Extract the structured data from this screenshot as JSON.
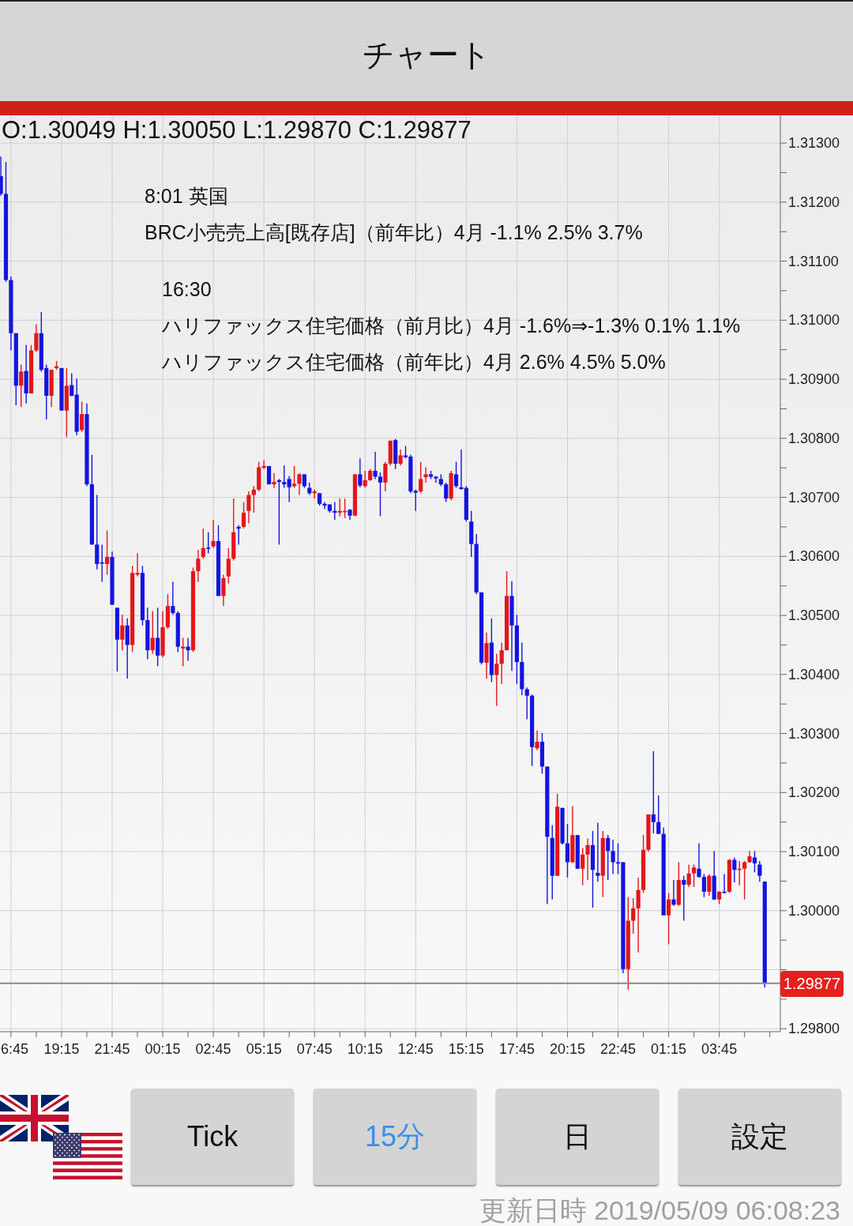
{
  "title": "チャート",
  "chart": {
    "ohlc_readout": "O:1.30049 H:1.30050 L:1.29870 C:1.29877",
    "events": [
      {
        "heading": "8:01 英国",
        "lines": [
          "BRC小売売上高[既存店]（前年比）4月 -1.1% 2.5% 3.7%"
        ]
      },
      {
        "heading": "16:30",
        "lines": [
          "ハリファックス住宅価格（前月比）4月 -1.6%⇒-1.3% 0.1% 1.1%",
          "ハリファックス住宅価格（前年比）4月 2.6% 4.5% 5.0%"
        ]
      }
    ],
    "chart_data": {
      "type": "candlestick",
      "grid": true,
      "categories": [
        null,
        null,
        "6:45",
        null,
        null,
        null,
        null,
        null,
        null,
        null,
        null,
        null,
        "19:15",
        null,
        null,
        null,
        null,
        null,
        null,
        null,
        null,
        null,
        "21:45",
        null,
        null,
        null,
        null,
        null,
        null,
        null,
        null,
        null,
        "00:15",
        null,
        null,
        null,
        null,
        null,
        null,
        null,
        null,
        null,
        "02:45",
        null,
        null,
        null,
        null,
        null,
        null,
        null,
        null,
        null,
        "05:15",
        null,
        null,
        null,
        null,
        null,
        null,
        null,
        null,
        null,
        "07:45",
        null,
        null,
        null,
        null,
        null,
        null,
        null,
        null,
        null,
        "10:15",
        null,
        null,
        null,
        null,
        null,
        null,
        null,
        null,
        null,
        "12:45",
        null,
        null,
        null,
        null,
        null,
        null,
        null,
        null,
        null,
        "15:15",
        null,
        null,
        null,
        null,
        null,
        null,
        null,
        null,
        null,
        "17:45",
        null,
        null,
        null,
        null,
        null,
        null,
        null,
        null,
        null,
        "20:15",
        null,
        null,
        null,
        null,
        null,
        null,
        null,
        null,
        null,
        "22:45",
        null,
        null,
        null,
        null,
        null,
        null,
        null,
        null,
        null,
        "01:15",
        null,
        null,
        null,
        null,
        null,
        null,
        null,
        null,
        null,
        "03:45",
        null,
        null,
        null,
        null,
        null,
        null,
        null,
        null,
        null
      ],
      "ohlc": [
        [
          1.31244,
          1.31277,
          1.31211,
          1.31214
        ],
        [
          1.31214,
          1.31268,
          1.31065,
          1.31068
        ],
        [
          1.31068,
          1.31074,
          1.30949,
          1.30978
        ],
        [
          1.30978,
          1.30978,
          1.30856,
          1.30889
        ],
        [
          1.30889,
          1.30925,
          1.30853,
          1.30913
        ],
        [
          1.30914,
          1.30958,
          1.30859,
          1.30876
        ],
        [
          1.30876,
          1.30958,
          1.30876,
          1.30949
        ],
        [
          1.30949,
          1.30993,
          1.30946,
          1.30978
        ],
        [
          1.30978,
          1.31014,
          1.30913,
          1.30916
        ],
        [
          1.30919,
          1.30925,
          1.30832,
          1.30872
        ],
        [
          1.30872,
          1.30916,
          1.30853,
          1.30916
        ],
        [
          1.30919,
          1.30931,
          1.30916,
          1.30922
        ],
        [
          1.30919,
          1.30919,
          1.30847,
          1.30847
        ],
        [
          1.30847,
          1.30919,
          1.30802,
          1.30889
        ],
        [
          1.3089,
          1.3091,
          1.30871,
          1.30872
        ],
        [
          1.30874,
          1.30901,
          1.30805,
          1.30811
        ],
        [
          1.30814,
          1.30862,
          1.30811,
          1.30841
        ],
        [
          1.30841,
          1.30859,
          1.30719,
          1.30722
        ],
        [
          1.30722,
          1.30772,
          1.3062,
          1.3062
        ],
        [
          1.3062,
          1.30704,
          1.30578,
          1.30587
        ],
        [
          1.3059,
          1.3062,
          1.30557,
          1.30588
        ],
        [
          1.30587,
          1.30644,
          1.30569,
          1.30599
        ],
        [
          1.30599,
          1.30608,
          1.30518,
          1.30518
        ],
        [
          1.30513,
          1.30513,
          1.30405,
          1.30459
        ],
        [
          1.30459,
          1.30501,
          1.30441,
          1.30483
        ],
        [
          1.30483,
          1.30495,
          1.30393,
          1.3045
        ],
        [
          1.3045,
          1.30584,
          1.30438,
          1.30572
        ],
        [
          1.30569,
          1.30605,
          1.30566,
          1.30572
        ],
        [
          1.30572,
          1.30584,
          1.30483,
          1.30492
        ],
        [
          1.30492,
          1.30513,
          1.30426,
          1.30441
        ],
        [
          1.30441,
          1.30507,
          1.30435,
          1.30462
        ],
        [
          1.30462,
          1.30513,
          1.30414,
          1.30432
        ],
        [
          1.30432,
          1.30507,
          1.30429,
          1.3048
        ],
        [
          1.3048,
          1.30536,
          1.30477,
          1.30516
        ],
        [
          1.30516,
          1.30557,
          1.30501,
          1.30504
        ],
        [
          1.30504,
          1.30507,
          1.30438,
          1.30447
        ],
        [
          1.30444,
          1.30462,
          1.30414,
          1.30447
        ],
        [
          1.30447,
          1.30462,
          1.30423,
          1.30441
        ],
        [
          1.30441,
          1.30581,
          1.30438,
          1.30575
        ],
        [
          1.30575,
          1.30611,
          1.30557,
          1.30596
        ],
        [
          1.30599,
          1.30647,
          1.30596,
          1.30614
        ],
        [
          1.30615,
          1.30641,
          1.30605,
          1.30613
        ],
        [
          1.30617,
          1.30662,
          1.30614,
          1.30626
        ],
        [
          1.30626,
          1.30653,
          1.30533,
          1.30533
        ],
        [
          1.30533,
          1.30569,
          1.30516,
          1.30563
        ],
        [
          1.30566,
          1.30614,
          1.30554,
          1.30596
        ],
        [
          1.30596,
          1.30698,
          1.30593,
          1.30641
        ],
        [
          1.3065,
          1.30653,
          1.3062,
          1.30647
        ],
        [
          1.3065,
          1.30692,
          1.30647,
          1.30674
        ],
        [
          1.30677,
          1.3071,
          1.30656,
          1.30704
        ],
        [
          1.30704,
          1.30719,
          1.30674,
          1.30713
        ],
        [
          1.30713,
          1.3076,
          1.3071,
          1.30751
        ],
        [
          1.3075,
          1.30763,
          1.30748,
          1.30753
        ],
        [
          1.30753,
          1.30753,
          1.30722,
          1.30722
        ],
        [
          1.30722,
          1.30741,
          1.30716,
          1.30726
        ],
        [
          1.30729,
          1.30731,
          1.3062,
          1.30726
        ],
        [
          1.30726,
          1.30754,
          1.30716,
          1.30722
        ],
        [
          1.30731,
          1.30736,
          1.30692,
          1.30717
        ],
        [
          1.30719,
          1.30753,
          1.30716,
          1.30723
        ],
        [
          1.30723,
          1.30741,
          1.30704,
          1.30739
        ],
        [
          1.30739,
          1.30739,
          1.30716,
          1.30719
        ],
        [
          1.30716,
          1.30725,
          1.30704,
          1.30707
        ],
        [
          1.30707,
          1.30713,
          1.30698,
          1.3071
        ],
        [
          1.30707,
          1.30707,
          1.30686,
          1.30689
        ],
        [
          1.30689,
          1.30692,
          1.3068,
          1.30686
        ],
        [
          1.30688,
          1.30688,
          1.30674,
          1.30677
        ],
        [
          1.30677,
          1.30692,
          1.30662,
          1.30674
        ],
        [
          1.30674,
          1.30698,
          1.30668,
          1.30677
        ],
        [
          1.30675,
          1.30698,
          1.30665,
          1.30677
        ],
        [
          1.30679,
          1.3068,
          1.30662,
          1.30669
        ],
        [
          1.30669,
          1.30739,
          1.30668,
          1.30739
        ],
        [
          1.30739,
          1.30766,
          1.30717,
          1.3072
        ],
        [
          1.30719,
          1.30745,
          1.30716,
          1.30729
        ],
        [
          1.30729,
          1.30748,
          1.30728,
          1.30745
        ],
        [
          1.30745,
          1.30777,
          1.30731,
          1.30735
        ],
        [
          1.30735,
          1.30742,
          1.30668,
          1.30725
        ],
        [
          1.30725,
          1.3076,
          1.3071,
          1.30757
        ],
        [
          1.30757,
          1.30796,
          1.30754,
          1.30796
        ],
        [
          1.30797,
          1.30799,
          1.30748,
          1.30757
        ],
        [
          1.30757,
          1.30781,
          1.30754,
          1.30771
        ],
        [
          1.30771,
          1.30787,
          1.30766,
          1.30768
        ],
        [
          1.30769,
          1.30772,
          1.30707,
          1.3071
        ],
        [
          1.30711,
          1.30713,
          1.30677,
          1.30708
        ],
        [
          1.3071,
          1.3076,
          1.30707,
          1.30731
        ],
        [
          1.30734,
          1.30751,
          1.30725,
          1.30739
        ],
        [
          1.30739,
          1.30745,
          1.30731,
          1.30735
        ],
        [
          1.30735,
          1.30736,
          1.30725,
          1.30732
        ],
        [
          1.30731,
          1.30739,
          1.30719,
          1.30722
        ],
        [
          1.30722,
          1.30725,
          1.30692,
          1.30698
        ],
        [
          1.30698,
          1.30745,
          1.30695,
          1.30741
        ],
        [
          1.30739,
          1.3076,
          1.30716,
          1.30719
        ],
        [
          1.30717,
          1.30781,
          1.30713,
          1.30714
        ],
        [
          1.30716,
          1.30719,
          1.30659,
          1.30662
        ],
        [
          1.30659,
          1.30677,
          1.30599,
          1.30621
        ],
        [
          1.30621,
          1.30638,
          1.30536,
          1.30539
        ],
        [
          1.30539,
          1.30539,
          1.30417,
          1.3042
        ],
        [
          1.3042,
          1.30471,
          1.30393,
          1.30453
        ],
        [
          1.30454,
          1.30495,
          1.30387,
          1.30399
        ],
        [
          1.30399,
          1.30435,
          1.30347,
          1.30418
        ],
        [
          1.30418,
          1.30454,
          1.30384,
          1.30441
        ],
        [
          1.30441,
          1.30575,
          1.30441,
          1.30533
        ],
        [
          1.30533,
          1.30558,
          1.30406,
          1.30483
        ],
        [
          1.30483,
          1.30501,
          1.30384,
          1.30421
        ],
        [
          1.30421,
          1.30454,
          1.30365,
          1.30375
        ],
        [
          1.30375,
          1.30378,
          1.30324,
          1.30364
        ],
        [
          1.30364,
          1.30366,
          1.30245,
          1.30277
        ],
        [
          1.30275,
          1.30305,
          1.30272,
          1.30286
        ],
        [
          1.30286,
          1.30301,
          1.30232,
          1.30244
        ],
        [
          1.30244,
          1.30244,
          1.30011,
          1.30125
        ],
        [
          1.30123,
          1.30145,
          1.30019,
          1.30059
        ],
        [
          1.30059,
          1.30198,
          1.30059,
          1.30176
        ],
        [
          1.30174,
          1.30174,
          1.30112,
          1.30114
        ],
        [
          1.30114,
          1.30147,
          1.30056,
          1.30082
        ],
        [
          1.30082,
          1.30177,
          1.30081,
          1.30128
        ],
        [
          1.30128,
          1.30128,
          1.30071,
          1.30071
        ],
        [
          1.30071,
          1.30106,
          1.30043,
          1.30095
        ],
        [
          1.30095,
          1.30122,
          1.30052,
          1.30111
        ],
        [
          1.30111,
          1.30135,
          1.30005,
          1.30069
        ],
        [
          1.30064,
          1.30149,
          1.30049,
          1.30059
        ],
        [
          1.30059,
          1.30135,
          1.30023,
          1.30123
        ],
        [
          1.30123,
          1.30128,
          1.30052,
          1.30101
        ],
        [
          1.30101,
          1.3012,
          1.30062,
          1.30082
        ],
        [
          1.30082,
          1.30114,
          1.30062,
          1.3008
        ],
        [
          1.30082,
          1.30082,
          1.29894,
          1.29901
        ],
        [
          1.29901,
          1.30023,
          1.29866,
          1.29983
        ],
        [
          1.29983,
          1.30021,
          1.29961,
          1.30004
        ],
        [
          1.30004,
          1.30056,
          1.29929,
          1.30035
        ],
        [
          1.30035,
          1.30128,
          1.3003,
          1.30103
        ],
        [
          1.30103,
          1.30163,
          1.301,
          1.30163
        ],
        [
          1.30163,
          1.3027,
          1.30131,
          1.3015
        ],
        [
          1.3015,
          1.30195,
          1.3013,
          1.3013
        ],
        [
          1.3013,
          1.30141,
          1.29992,
          1.29992
        ],
        [
          1.29992,
          1.3003,
          1.29943,
          1.30019
        ],
        [
          1.30019,
          1.30052,
          1.30008,
          1.3001
        ],
        [
          1.3001,
          1.30082,
          1.30008,
          1.30052
        ],
        [
          1.30052,
          1.30059,
          1.29983,
          1.30044
        ],
        [
          1.30044,
          1.30078,
          1.3004,
          1.30063
        ],
        [
          1.30063,
          1.30078,
          1.3004,
          1.30073
        ],
        [
          1.30071,
          1.30114,
          1.30056,
          1.30057
        ],
        [
          1.30057,
          1.30062,
          1.30023,
          1.30032
        ],
        [
          1.30032,
          1.30062,
          1.30025,
          1.30059
        ],
        [
          1.30059,
          1.30101,
          1.30018,
          1.30019
        ],
        [
          1.30019,
          1.30033,
          1.30011,
          1.30032
        ],
        [
          1.30032,
          1.30062,
          1.30029,
          1.3003
        ],
        [
          1.30032,
          1.30087,
          1.3003,
          1.30086
        ],
        [
          1.30086,
          1.3009,
          1.30048,
          1.30069
        ],
        [
          1.30069,
          1.30084,
          1.30043,
          1.30071
        ],
        [
          1.30071,
          1.30084,
          1.30019,
          1.30082
        ],
        [
          1.30082,
          1.30101,
          1.30081,
          1.30092
        ],
        [
          1.3009,
          1.30101,
          1.30065,
          1.3008
        ],
        [
          1.30078,
          1.30084,
          1.30049,
          1.30059
        ],
        [
          1.30049,
          1.3005,
          1.2987,
          1.29877
        ]
      ],
      "ref_lines": [
        {
          "axis": "y",
          "value": 1.29877,
          "label": "1.29877"
        }
      ],
      "ylim": [
        1.29795,
        1.31347
      ],
      "yticks": [
        {
          "value": 1.313,
          "label": "1.31300"
        },
        {
          "value": 1.312,
          "label": "1.31200"
        },
        {
          "value": 1.311,
          "label": "1.31100"
        },
        {
          "value": 1.31,
          "label": "1.31000"
        },
        {
          "value": 1.309,
          "label": "1.30900"
        },
        {
          "value": 1.308,
          "label": "1.30800"
        },
        {
          "value": 1.307,
          "label": "1.30700"
        },
        {
          "value": 1.306,
          "label": "1.30600"
        },
        {
          "value": 1.305,
          "label": "1.30500"
        },
        {
          "value": 1.304,
          "label": "1.30400"
        },
        {
          "value": 1.303,
          "label": "1.30300"
        },
        {
          "value": 1.302,
          "label": "1.30200"
        },
        {
          "value": 1.301,
          "label": "1.30100"
        },
        {
          "value": 1.3,
          "label": "1.30000"
        },
        {
          "value": 1.298,
          "label": "1.29800"
        }
      ]
    }
  },
  "period_tabs": [
    {
      "label": "Tick",
      "selected": false
    },
    {
      "label": "15分",
      "selected": true
    },
    {
      "label": "日",
      "selected": false
    }
  ],
  "settings_button": {
    "label": "設定"
  },
  "update_time": "更新日時 2019/05/09 06:08:23"
}
